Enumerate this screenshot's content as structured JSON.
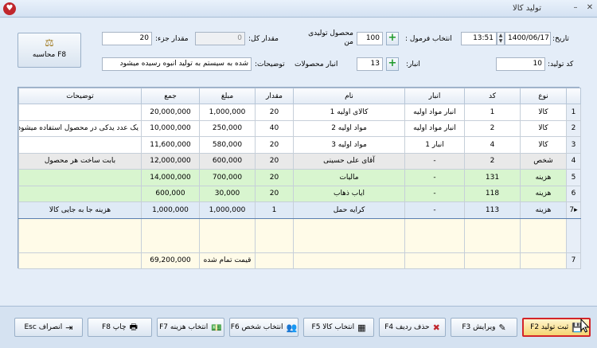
{
  "titlebar": {
    "title": "تولید کالا",
    "minimize": "–",
    "close": "✕"
  },
  "form": {
    "date_label": "تاریخ:",
    "date_value": "1400/06/17",
    "time_value": "13:51",
    "formula_label": "انتخاب فرمول :",
    "product_qty_label": "محصول تولیدی من",
    "product_qty_value": "100",
    "total_qty_label": "مقدار کل:",
    "total_qty_value": "0",
    "part_qty_label": "مقدار جزء:",
    "part_qty_value": "20",
    "code_label": "کد تولید:",
    "code_value": "10",
    "warehouse_label": "انبار:",
    "products_warehouse_label": "انبار محصولات",
    "products_warehouse_value": "13",
    "notes_label": "توضیحات:",
    "notes_value": "شده به سیستم به تولید انبوه رسیده میشود",
    "calc_button": "محاسبه F8"
  },
  "table": {
    "headers": [
      "",
      "نوع",
      "کد",
      "انبار",
      "نام",
      "مقدار",
      "مبلغ",
      "جمع",
      "توضیحات"
    ],
    "rows": [
      {
        "n": "1",
        "type": "کالا",
        "code": "1",
        "wh": "انبار مواد اولیه",
        "name": "کالای اولیه 1",
        "qty": "20",
        "price": "1,000,000",
        "sum": "20,000,000",
        "desc": ""
      },
      {
        "n": "2",
        "type": "کالا",
        "code": "2",
        "wh": "انبار مواد اولیه",
        "name": "مواد اولیه 2",
        "qty": "40",
        "price": "250,000",
        "sum": "10,000,000",
        "desc": "یک عدد یدکی در محصول استفاده میشود"
      },
      {
        "n": "3",
        "type": "کالا",
        "code": "4",
        "wh": "انبار 1",
        "name": "مواد اولیه 3",
        "qty": "20",
        "price": "580,000",
        "sum": "11,600,000",
        "desc": ""
      },
      {
        "n": "4",
        "type": "شخص",
        "code": "2",
        "wh": "-",
        "name": "آقای علی حسینی",
        "qty": "20",
        "price": "600,000",
        "sum": "12,000,000",
        "desc": "بابت ساخت هر محصول"
      },
      {
        "n": "5",
        "type": "هزینه",
        "code": "131",
        "wh": "-",
        "name": "مالیات",
        "qty": "20",
        "price": "700,000",
        "sum": "14,000,000",
        "desc": ""
      },
      {
        "n": "6",
        "type": "هزینه",
        "code": "118",
        "wh": "-",
        "name": "ایاب ذهاب",
        "qty": "20",
        "price": "30,000",
        "sum": "600,000",
        "desc": ""
      },
      {
        "n": "7",
        "type": "هزینه",
        "code": "113",
        "wh": "-",
        "name": "کرایه حمل",
        "qty": "1",
        "price": "1,000,000",
        "sum": "1,000,000",
        "desc": "هزینه جا به جایی کالا"
      }
    ],
    "total_row_num": "7",
    "total_label": "قیمت تمام شده",
    "total_value": "69,200,000"
  },
  "toolbar": {
    "save": "ثبت تولید F2",
    "edit": "ویرایش F3",
    "delete_row": "حذف ردیف F4",
    "select_item": "انتخاب کالا F5",
    "select_person": "انتخاب شخص F6",
    "select_cost": "انتخاب هزینه F7",
    "print": "چاپ F8",
    "cancel": "انصراف Esc"
  },
  "colors": {
    "highlight_border": "#d3252a",
    "plus_green": "#1e9a2a",
    "row_green": "#d8f5cf",
    "row_gray": "#e9e9e9"
  }
}
